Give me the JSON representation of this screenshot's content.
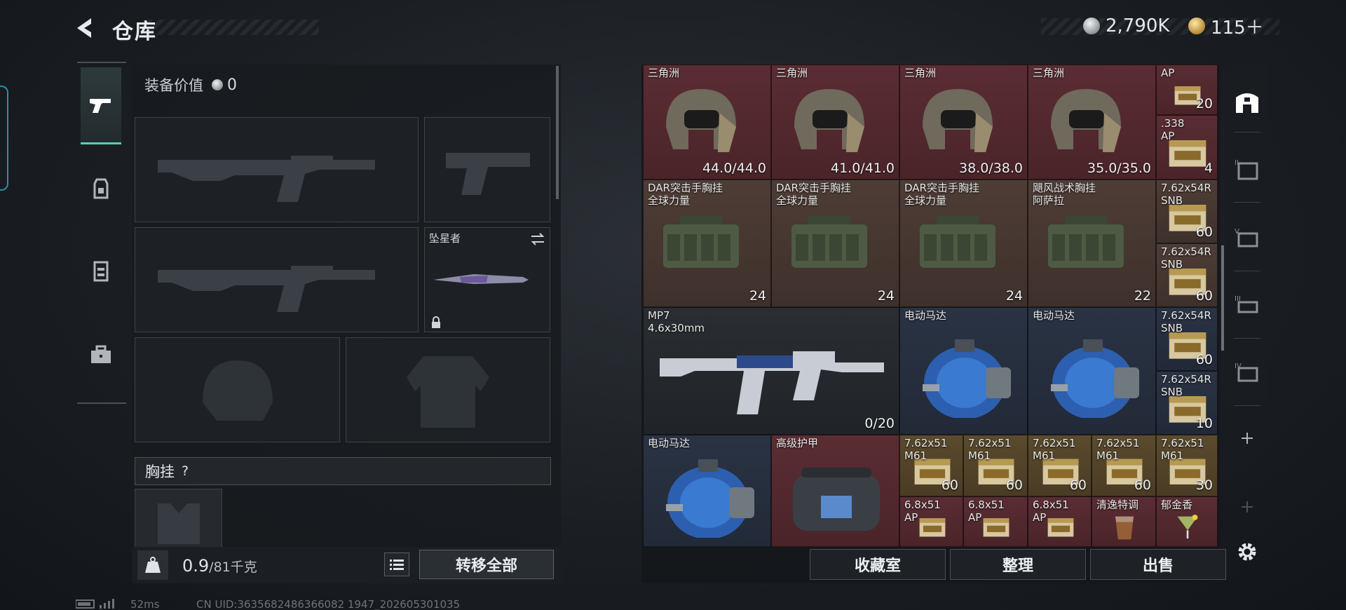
{
  "header": {
    "title": "仓库",
    "currency": [
      {
        "icon": "silver-coin-icon",
        "value": "2,790K"
      },
      {
        "icon": "gold-coin-icon",
        "value": "115＋"
      }
    ]
  },
  "loadout": {
    "equip_value_label": "装备价值",
    "equip_value": "0",
    "melee_label": "坠星者",
    "chest_label": "胸挂",
    "chest_help": "?",
    "weight": "0.9",
    "weight_max": "/81千克",
    "transfer_all": "转移全部"
  },
  "storage": {
    "cells": [
      {
        "name": "三角洲",
        "value": "44.0/44.0",
        "icon": "helmet-icon",
        "color": "red"
      },
      {
        "name": "三角洲",
        "value": "41.0/41.0",
        "icon": "helmet-icon",
        "color": "red"
      },
      {
        "name": "三角洲",
        "value": "38.0/38.0",
        "icon": "helmet-icon",
        "color": "red"
      },
      {
        "name": "三角洲",
        "value": "35.0/35.0",
        "icon": "helmet-icon",
        "color": "red"
      },
      {
        "name": "AP",
        "value": "20",
        "icon": "ammo-box-icon",
        "color": "red"
      },
      {
        "name": ".338\nAP",
        "value": "4",
        "icon": "ammo-box-icon",
        "color": "red"
      },
      {
        "name": "DAR突击手胸挂\n全球力量",
        "value": "24",
        "icon": "chest-rig-icon",
        "color": "brown"
      },
      {
        "name": "DAR突击手胸挂\n全球力量",
        "value": "24",
        "icon": "chest-rig-icon",
        "color": "brown"
      },
      {
        "name": "DAR突击手胸挂\n全球力量",
        "value": "24",
        "icon": "chest-rig-icon",
        "color": "brown"
      },
      {
        "name": "飓风战术胸挂\n阿萨拉",
        "value": "22",
        "icon": "chest-rig-icon",
        "color": "brown"
      },
      {
        "name": "7.62x54R\nSNB",
        "value": "60",
        "icon": "ammo-box-icon",
        "color": "brown"
      },
      {
        "name": "7.62x54R\nSNB",
        "value": "60",
        "icon": "ammo-box-icon",
        "color": "brown"
      },
      {
        "name": "MP7\n4.6x30mm",
        "value": "0/20",
        "icon": "smg-icon",
        "color": "dark"
      },
      {
        "name": "电动马达",
        "value": "",
        "icon": "motor-icon",
        "color": "blue"
      },
      {
        "name": "电动马达",
        "value": "",
        "icon": "motor-icon",
        "color": "blue"
      },
      {
        "name": "7.62x54R\nSNB",
        "value": "60",
        "icon": "ammo-box-icon",
        "color": "blue"
      },
      {
        "name": "7.62x54R\nSNB",
        "value": "10",
        "icon": "ammo-box-icon",
        "color": "blue"
      },
      {
        "name": "电动马达",
        "value": "",
        "icon": "motor-icon",
        "color": "blue"
      },
      {
        "name": "高级护甲",
        "value": "",
        "icon": "armor-bag-icon",
        "color": "red"
      },
      {
        "name": "7.62x51\nM61",
        "value": "60",
        "icon": "ammo-box-icon",
        "color": "gold"
      },
      {
        "name": "7.62x51\nM61",
        "value": "60",
        "icon": "ammo-box-icon",
        "color": "gold"
      },
      {
        "name": "7.62x51\nM61",
        "value": "60",
        "icon": "ammo-box-icon",
        "color": "gold"
      },
      {
        "name": "7.62x51\nM61",
        "value": "60",
        "icon": "ammo-box-icon",
        "color": "gold"
      },
      {
        "name": "7.62x51\nM61",
        "value": "30",
        "icon": "ammo-box-icon",
        "color": "gold"
      },
      {
        "name": "6.8x51\nAP",
        "value": "",
        "icon": "ammo-box-icon",
        "color": "red"
      },
      {
        "name": "6.8x51\nAP",
        "value": "",
        "icon": "ammo-box-icon",
        "color": "red"
      },
      {
        "name": "6.8x51\nAP",
        "value": "",
        "icon": "ammo-box-icon",
        "color": "red"
      },
      {
        "name": "清逸特调",
        "value": "",
        "icon": "drink-icon",
        "color": "red"
      },
      {
        "name": "郁金香",
        "value": "",
        "icon": "cocktail-icon",
        "color": "red"
      }
    ]
  },
  "actions": {
    "collection": "收藏室",
    "organize": "整理",
    "sell": "出售"
  },
  "footer": {
    "ping": "52ms",
    "uid": "CN UID:3635682486366082 1947_202605301035"
  }
}
